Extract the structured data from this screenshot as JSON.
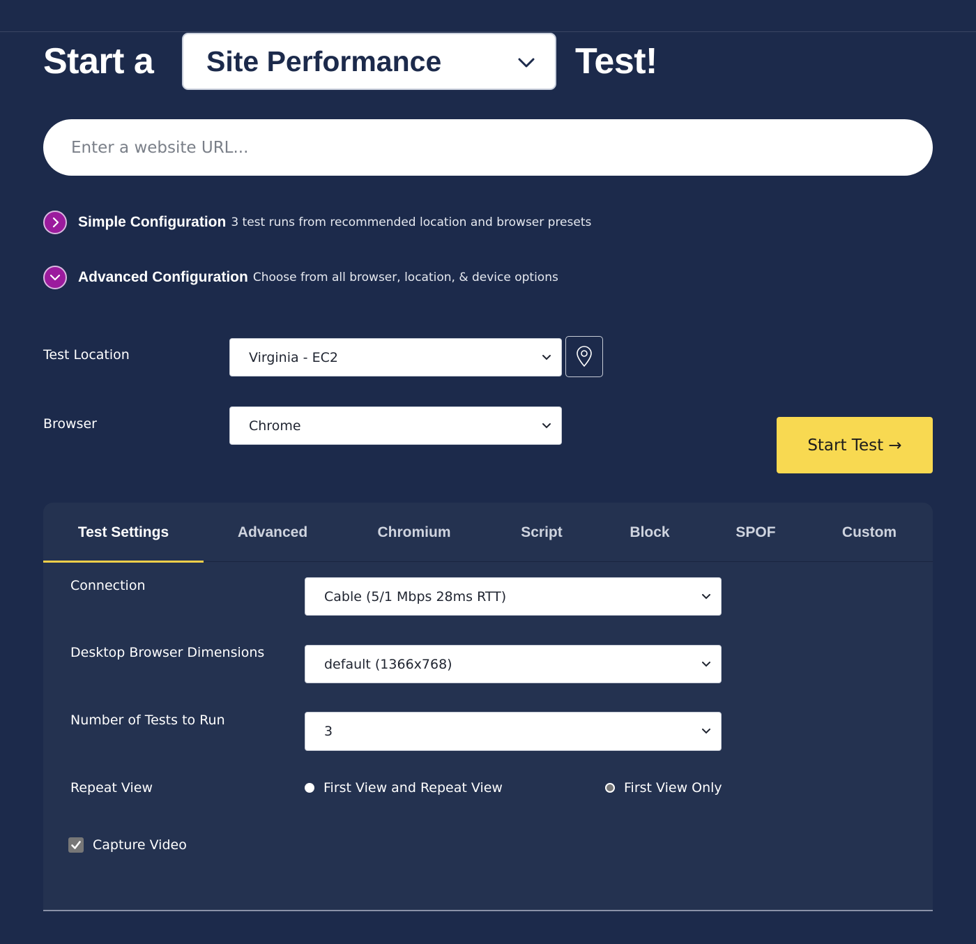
{
  "headline": {
    "prefix": "Start a",
    "test_type": "Site Performance",
    "suffix": "Test!"
  },
  "url_input": {
    "placeholder": "Enter a website URL...",
    "value": ""
  },
  "configurations": [
    {
      "title": "Simple Configuration",
      "description": "3 test runs from recommended location and browser presets",
      "icon": "chevron-right-icon",
      "expanded": false
    },
    {
      "title": "Advanced Configuration",
      "description": "Choose from all browser, location, & device options",
      "icon": "chevron-down-icon",
      "expanded": true
    }
  ],
  "test_location": {
    "label": "Test Location",
    "value": "Virginia - EC2",
    "map_icon": "map-pin-icon"
  },
  "browser": {
    "label": "Browser",
    "value": "Chrome"
  },
  "start_button": {
    "label": "Start Test →"
  },
  "tabs": [
    {
      "label": "Test Settings",
      "active": true
    },
    {
      "label": "Advanced",
      "active": false
    },
    {
      "label": "Chromium",
      "active": false
    },
    {
      "label": "Script",
      "active": false
    },
    {
      "label": "Block",
      "active": false
    },
    {
      "label": "SPOF",
      "active": false
    },
    {
      "label": "Custom",
      "active": false
    }
  ],
  "settings": {
    "connection": {
      "label": "Connection",
      "value": "Cable (5/1 Mbps 28ms RTT)"
    },
    "dimensions": {
      "label": "Desktop Browser Dimensions",
      "value": "default (1366x768)"
    },
    "num_tests": {
      "label": "Number of Tests to Run",
      "value": "3"
    },
    "repeat_view": {
      "label": "Repeat View",
      "options": [
        {
          "label": "First View and Repeat View",
          "checked": false
        },
        {
          "label": "First View Only",
          "checked": true
        }
      ]
    },
    "capture_video": {
      "label": "Capture Video",
      "checked": true
    }
  },
  "colors": {
    "background": "#1c2a4b",
    "panel": "#243250",
    "accent_yellow": "#f8d951",
    "accent_purple": "#9b1b9d"
  }
}
